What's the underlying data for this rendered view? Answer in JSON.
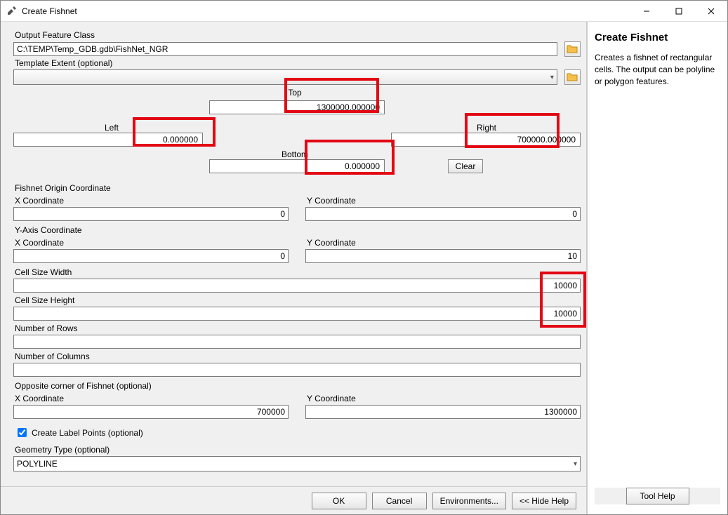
{
  "window": {
    "title": "Create Fishnet"
  },
  "labels": {
    "output": "Output Feature Class",
    "template": "Template Extent (optional)",
    "top": "Top",
    "left": "Left",
    "right": "Right",
    "bottom": "Bottom",
    "clear": "Clear",
    "origin": "Fishnet Origin Coordinate",
    "xcoord": "X Coordinate",
    "ycoord": "Y Coordinate",
    "yaxis": "Y-Axis Coordinate",
    "cellw": "Cell Size Width",
    "cellh": "Cell Size Height",
    "nrows": "Number of Rows",
    "ncols": "Number of Columns",
    "opposite": "Opposite corner of Fishnet (optional)",
    "labelpoints": "Create Label Points (optional)",
    "geomtype": "Geometry Type (optional)"
  },
  "values": {
    "output_path": "C:\\TEMP\\Temp_GDB.gdb\\FishNet_NGR",
    "template": "",
    "top": "1300000.000000",
    "left": "0.000000",
    "right": "700000.000000",
    "bottom": "0.000000",
    "origin_x": "0",
    "origin_y": "0",
    "yaxis_x": "0",
    "yaxis_y": "10",
    "cellw": "10000",
    "cellh": "10000",
    "nrows": "",
    "ncols": "",
    "opp_x": "700000",
    "opp_y": "1300000",
    "labelpoints_checked": true,
    "geomtype": "POLYLINE"
  },
  "buttons": {
    "ok": "OK",
    "cancel": "Cancel",
    "env": "Environments...",
    "hide": "<< Hide Help",
    "toolhelp": "Tool Help"
  },
  "help": {
    "title": "Create Fishnet",
    "body": "Creates a fishnet of rectangular cells. The output can be polyline or polygon features."
  }
}
